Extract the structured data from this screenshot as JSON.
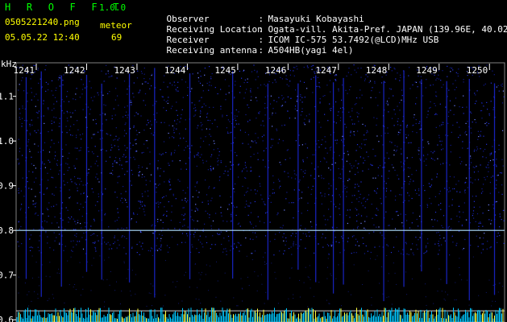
{
  "app": {
    "title": "H R O F F T",
    "version": "1.0.0"
  },
  "file": {
    "name": "0505221240.png",
    "datetime": "05.05.22 12:40"
  },
  "meteor": {
    "label": "meteor",
    "count": "69"
  },
  "info": [
    {
      "key": "Observer",
      "sep": ":",
      "value": "Masayuki Kobayashi"
    },
    {
      "key": "Receiving Location",
      "sep": ":",
      "value": "Ogata-vill. Akita-Pref. JAPAN (139.96E, 40.02N)"
    },
    {
      "key": "Receiver",
      "sep": ":",
      "value": "ICOM IC-575 53.7492(@LCD)MHz USB"
    },
    {
      "key": "Receiving antenna",
      "sep": ":",
      "value": "A504HB(yagi 4el)"
    }
  ],
  "colors": {
    "title_green": "#00ff00",
    "label_yellow": "#ffff00",
    "info_white": "#ffffff",
    "background": "#000000",
    "signal_blue": "#2030ff",
    "carrier_line": "#b0e0ff",
    "spectrum_cyan": "#00c8ff",
    "spectrum_yellow": "#ffff40"
  },
  "chart_data": {
    "type": "heatmap",
    "title": "",
    "xlabel": "",
    "ylabel": "kHz",
    "x_tick_labels": [
      "1241",
      "1242",
      "1243",
      "1244",
      "1245",
      "1246",
      "1247",
      "1248",
      "1249",
      "1250"
    ],
    "x_range": [
      1240.6,
      1250.3
    ],
    "y_tick_labels": [
      "1.1",
      "1.0",
      "0.9",
      "0.8",
      "0.7",
      "0.6"
    ],
    "y_range": [
      0.595,
      1.175
    ],
    "carrier_frequency_khz": 0.8,
    "marker_line_khz": 0.62,
    "meteor_streak_minutes": [
      1240.8,
      1241.1,
      1241.5,
      1242.0,
      1242.3,
      1242.85,
      1243.35,
      1244.05,
      1244.9,
      1245.6,
      1246.2,
      1246.55,
      1246.9,
      1247.1,
      1247.9,
      1248.3,
      1248.65,
      1249.15,
      1249.6,
      1250.1
    ]
  }
}
